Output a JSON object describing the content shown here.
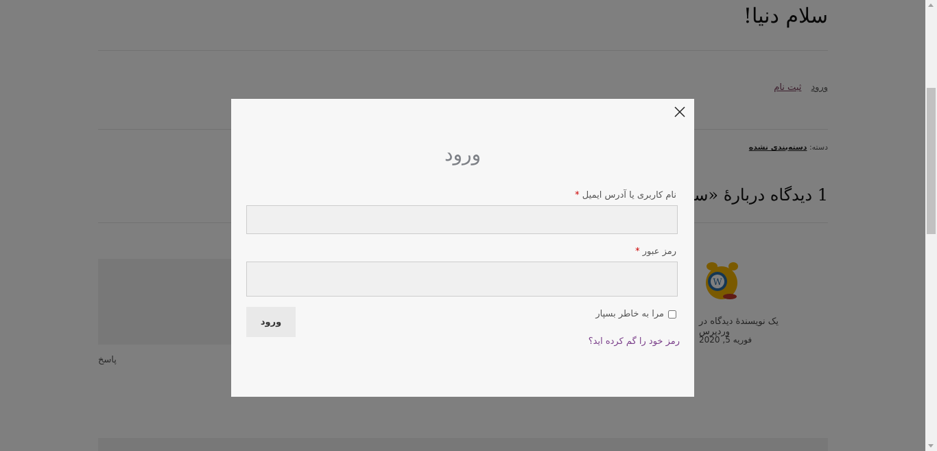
{
  "post": {
    "title": "سلام دنیا!",
    "login_link": "ورود",
    "register_link": "ثبت نام",
    "category_prefix": "دسته:",
    "category_name": "دسته‌بندی نشده",
    "comments_title": "1 دیدگاه دربارهٔ «سلام دنیا!»"
  },
  "comment": {
    "author": "یک نویسندهٔ دیدگاه در وردپرس",
    "date": "فوریه 5, 2020",
    "reply": "پاسخ"
  },
  "modal": {
    "title": "ورود",
    "username_label": "نام کاربری یا آدرس ایمیل",
    "password_label": "رمز عبور",
    "required_mark": "*",
    "username_value": "",
    "password_value": "",
    "remember_label": "مرا به خاطر بسپار",
    "remember_checked": false,
    "submit_label": "ورود",
    "lost_password": "رمز خود را گم کرده اید؟"
  },
  "colors": {
    "overlay": "#000000",
    "link": "#7a3e8a",
    "required": "#cc0000"
  }
}
